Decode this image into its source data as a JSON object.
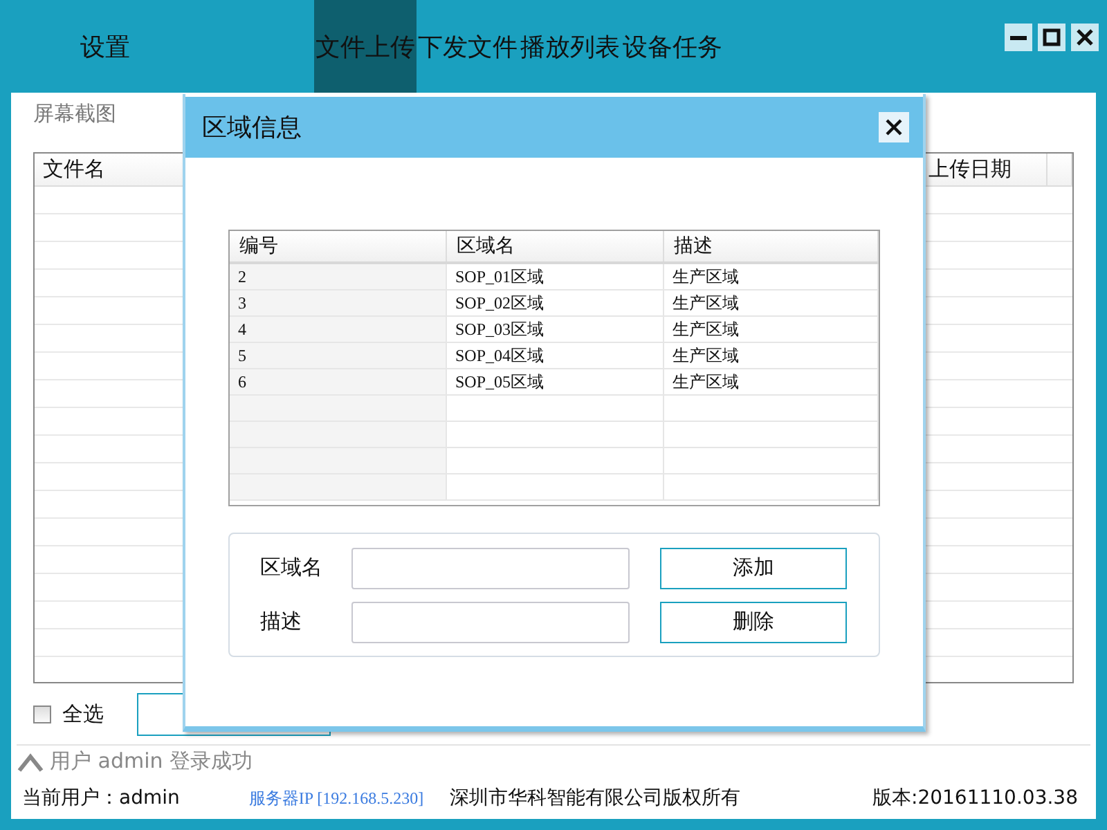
{
  "menu": [
    {
      "label": "设置",
      "selected": false
    },
    {
      "label": "文件上传",
      "selected": true
    },
    {
      "label": "下发文件",
      "selected": false
    },
    {
      "label": "播放列表",
      "selected": false
    },
    {
      "label": "设备任务",
      "selected": false
    }
  ],
  "panel": {
    "title": "屏幕截图",
    "columns": [
      "文件名",
      "上传日期"
    ],
    "select_all": {
      "label": "全选",
      "checked": false
    }
  },
  "status_message": "用户 admin 登录成功",
  "footer": {
    "user": "当前用户：admin",
    "server": "服务器IP [192.168.5.230]",
    "copyright": "深圳市华科智能有限公司版权所有",
    "version": "版本:20161110.03.38"
  },
  "dialog": {
    "title": "区域信息",
    "columns": [
      "编号",
      "区域名",
      "描述"
    ],
    "rows": [
      [
        "2",
        "SOP_01区域",
        "生产区域"
      ],
      [
        "3",
        "SOP_02区域",
        "生产区域"
      ],
      [
        "4",
        "SOP_03区域",
        "生产区域"
      ],
      [
        "5",
        "SOP_04区域",
        "生产区域"
      ],
      [
        "6",
        "SOP_05区域",
        "生产区域"
      ]
    ],
    "fields": [
      {
        "label": "区域名"
      },
      {
        "label": "描述"
      }
    ],
    "buttons": [
      "添加",
      "删除"
    ]
  }
}
